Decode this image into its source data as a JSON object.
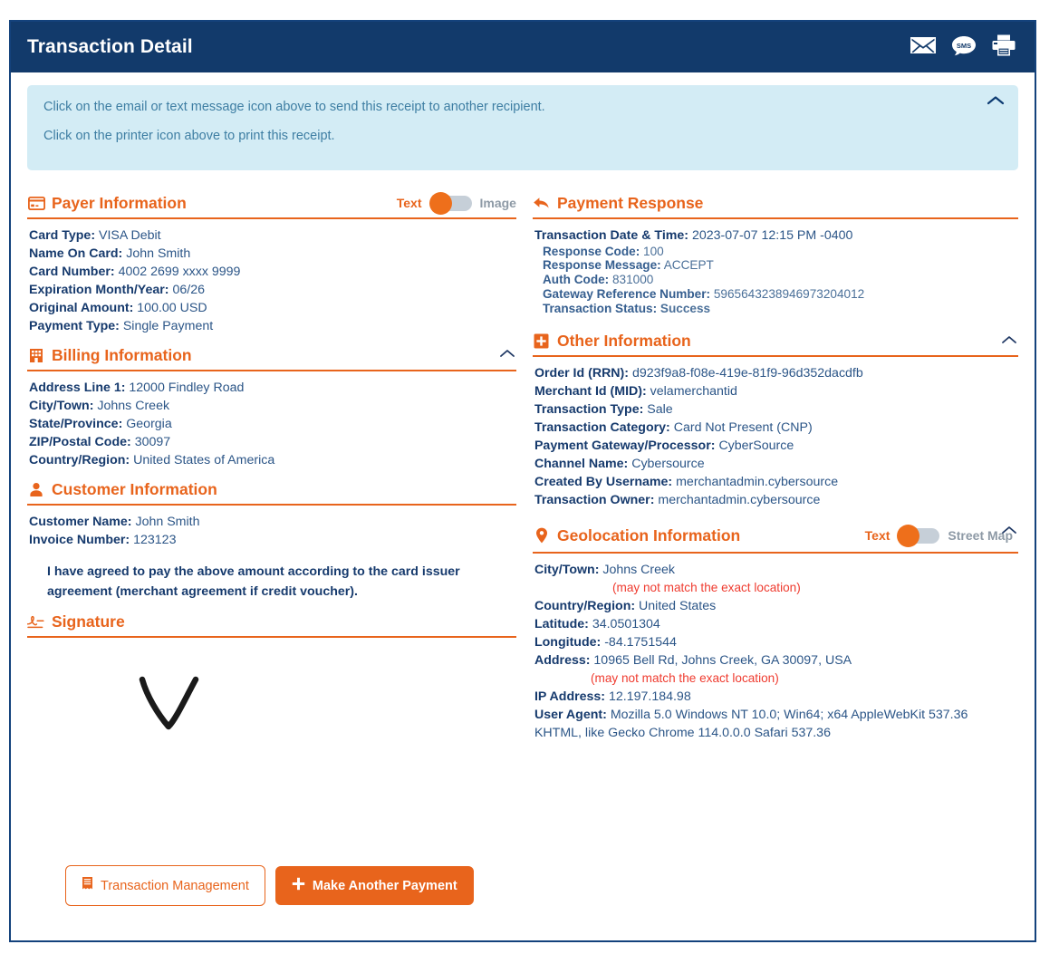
{
  "header": {
    "title": "Transaction Detail",
    "icons": [
      {
        "name": "email-icon",
        "label": "Email"
      },
      {
        "name": "sms-icon",
        "label": "SMS"
      },
      {
        "name": "printer-icon",
        "label": "Print"
      }
    ]
  },
  "banner": {
    "line1": "Click on the email or text message icon above to send this receipt to another recipient.",
    "line2": "Click on the printer icon above to print this receipt.",
    "collapse_icon": "chevron-up-icon"
  },
  "payer": {
    "title": "Payer Information",
    "icon": "credit-card-icon",
    "toggle": {
      "left_label": "Text",
      "right_label": "Image",
      "state": "Text"
    },
    "fields": [
      {
        "key": "Card Type:",
        "value": "VISA Debit"
      },
      {
        "key": "Name On Card:",
        "value": "John Smith"
      },
      {
        "key": "Card Number:",
        "value": "4002 2699 xxxx 9999"
      },
      {
        "key": "Expiration Month/Year:",
        "value": "06/26"
      },
      {
        "key": "Original Amount:",
        "value": "100.00 USD"
      },
      {
        "key": "Payment Type:",
        "value": "Single Payment"
      }
    ]
  },
  "billing": {
    "title": "Billing Information",
    "icon": "building-icon",
    "collapse_icon": "chevron-up-icon",
    "fields": [
      {
        "key": "Address Line 1:",
        "value": "12000 Findley Road"
      },
      {
        "key": "City/Town:",
        "value": "Johns Creek"
      },
      {
        "key": "State/Province:",
        "value": "Georgia"
      },
      {
        "key": "ZIP/Postal Code:",
        "value": "30097"
      },
      {
        "key": "Country/Region:",
        "value": "United States of America"
      }
    ]
  },
  "customer": {
    "title": "Customer Information",
    "icon": "person-icon",
    "fields": [
      {
        "key": "Customer Name:",
        "value": "John Smith"
      },
      {
        "key": "Invoice Number:",
        "value": "123123"
      }
    ],
    "agreement": "I have agreed to pay the above amount according to the card issuer agreement (merchant agreement if credit voucher)."
  },
  "signature": {
    "title": "Signature",
    "icon": "signature-icon"
  },
  "payment_response": {
    "title": "Payment Response",
    "icon": "reply-arrow-icon",
    "primary": {
      "key": "Transaction Date & Time:",
      "value": "2023-07-07 12:15 PM -0400"
    },
    "subfields": [
      {
        "key": "Response Code:",
        "value": "100"
      },
      {
        "key": "Response Message:",
        "value": "ACCEPT"
      },
      {
        "key": "Auth Code:",
        "value": "831000"
      },
      {
        "key": "Gateway Reference Number:",
        "value": "5965643238946973204012"
      },
      {
        "key": "Transaction Status:",
        "value": "Success",
        "status": "success"
      }
    ]
  },
  "other": {
    "title": "Other Information",
    "icon": "plus-square-icon",
    "collapse_icon": "chevron-up-icon",
    "fields": [
      {
        "key": "Order Id (RRN):",
        "value": "d923f9a8-f08e-419e-81f9-96d352dacdfb"
      },
      {
        "key": "Merchant Id (MID):",
        "value": "velamerchantid"
      },
      {
        "key": "Transaction Type:",
        "value": "Sale"
      },
      {
        "key": "Transaction Category:",
        "value": "Card Not Present (CNP)"
      },
      {
        "key": "Payment Gateway/Processor:",
        "value": "CyberSource"
      },
      {
        "key": "Channel Name:",
        "value": "Cybersource"
      },
      {
        "key": "Created By Username:",
        "value": "merchantadmin.cybersource"
      },
      {
        "key": "Transaction Owner:",
        "value": "merchantadmin.cybersource"
      }
    ]
  },
  "geolocation": {
    "title": "Geolocation Information",
    "icon": "map-pin-icon",
    "collapse_icon": "chevron-up-icon",
    "toggle": {
      "left_label": "Text",
      "right_label": "Street Map",
      "state": "Text"
    },
    "city": {
      "key": "City/Town:",
      "value": "Johns Creek"
    },
    "city_note": "(may not match the exact location)",
    "country": {
      "key": "Country/Region:",
      "value": "United States"
    },
    "latitude": {
      "key": "Latitude:",
      "value": "34.0501304"
    },
    "longitude": {
      "key": "Longitude:",
      "value": "-84.1751544"
    },
    "address": {
      "key": "Address:",
      "value": "10965 Bell Rd, Johns Creek, GA 30097, USA"
    },
    "address_note": "(may not match the exact location)",
    "ip": {
      "key": "IP Address:",
      "value": "12.197.184.98"
    },
    "user_agent": {
      "key": "User Agent:",
      "value": "Mozilla 5.0 Windows NT 10.0; Win64; x64 AppleWebKit 537.36 KHTML, like Gecko Chrome 114.0.0.0 Safari 537.36"
    }
  },
  "footer": {
    "transaction_management": "Transaction Management",
    "make_another_payment": "Make Another Payment"
  },
  "colors": {
    "header_navy": "#123a6b",
    "accent_orange": "#e8641c",
    "banner_blue": "#d3ecf5",
    "text_navy": "#1f3864",
    "success_green": "#2a8a2a",
    "warning_red": "#ef3b2f"
  }
}
